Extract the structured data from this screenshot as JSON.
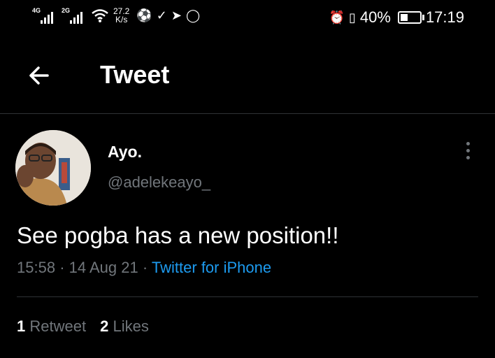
{
  "status_bar": {
    "signal1_label": "4G",
    "signal2_label": "2G",
    "speed_value": "27.2",
    "speed_unit": "K/s",
    "battery": "40%",
    "battery_level": 0.4,
    "time": "17:19"
  },
  "header": {
    "title": "Tweet"
  },
  "tweet": {
    "name": "Ayo.",
    "handle": "@adelekeayo_",
    "text": "See pogba has a new position!!",
    "time": "15:58",
    "date": "14 Aug 21",
    "source": "Twitter for iPhone"
  },
  "stats": {
    "retweets_count": "1",
    "retweets_label": "Retweet",
    "likes_count": "2",
    "likes_label": "Likes"
  }
}
